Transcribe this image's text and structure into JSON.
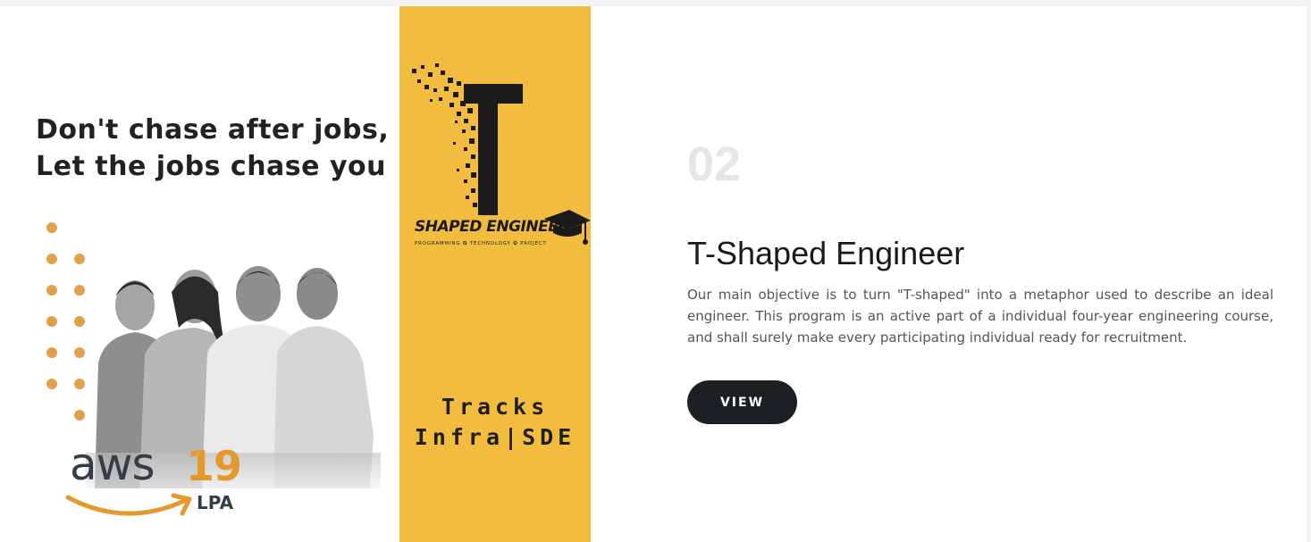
{
  "promo": {
    "headline_line1": "Don't chase after jobs,",
    "headline_line2": "Let the jobs chase you",
    "aws_word": "aws",
    "aws_number": "19",
    "aws_unit": "LPA",
    "accent_color": "#e0a14a"
  },
  "logo_panel": {
    "background": "#f2bc3f",
    "brand_text": "SHAPED ENGINEER",
    "brand_tagline": "PROGRAMMING ✪ TECHNOLOGY ✪ PROJECT",
    "tracks_line1": "Tracks",
    "tracks_line2": "Infra|SDE",
    "icons": [
      "t-letter-icon",
      "graduation-cap-icon"
    ]
  },
  "content": {
    "number": "02",
    "title": "T-Shaped Engineer",
    "description": "Our main objective is to turn \"T-shaped\" into a metaphor used to describe an ideal engineer. This program is an active part of a individual four-year engineering course, and shall surely make every participating individual ready for recruitment.",
    "button_label": "VIEW",
    "button_color": "#1b2024"
  }
}
